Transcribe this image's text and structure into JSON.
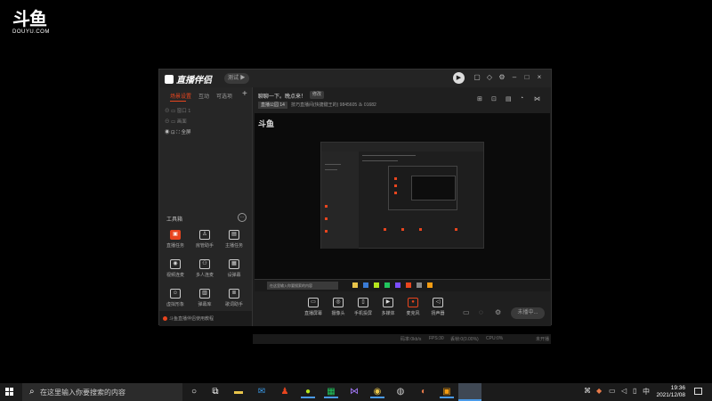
{
  "watermark": {
    "logo": "斗鱼",
    "sub": "DOUYU.COM"
  },
  "app": {
    "title": "直播伴侣",
    "version_badge": "测试 ▶",
    "main": {
      "room_title": "聊聊一下。晚点来！",
      "edit_label": "修改",
      "category": "直播公园 14",
      "room_info": "技巧直播间(快捷键王的)  9845605   ♨ 01682",
      "preview_logo": "斗鱼",
      "inner_search": "在这里输入你要搜索的内容"
    },
    "sidebar": {
      "tabs": [
        "场景设置",
        "互动",
        "可选项"
      ],
      "add_label": "+",
      "scenes": [
        "窗口 1",
        "画面",
        "全屏"
      ],
      "tools_title": "工具箱",
      "tools": [
        {
          "label": "直播任务",
          "icon": "task-icon"
        },
        {
          "label": "房管助手",
          "icon": "user-icon"
        },
        {
          "label": "主播任务",
          "icon": "gift-icon"
        },
        {
          "label": "视频连麦",
          "icon": "video-call-icon"
        },
        {
          "label": "多人连麦",
          "icon": "multi-call-icon"
        },
        {
          "label": "设弹幕",
          "icon": "barrage-icon"
        },
        {
          "label": "虚拟形象",
          "icon": "avatar-icon"
        },
        {
          "label": "弹幕库",
          "icon": "library-icon"
        },
        {
          "label": "歌词助手",
          "icon": "lyrics-icon"
        }
      ],
      "footer_tip": "斗鱼直播伴侣使用教程"
    },
    "controls": [
      {
        "label": "直播屏幕",
        "icon": "screen-icon"
      },
      {
        "label": "摄像头",
        "icon": "camera-icon"
      },
      {
        "label": "手机投屏",
        "icon": "phone-icon"
      },
      {
        "label": "多媒体",
        "icon": "media-icon"
      },
      {
        "label": "麦克风",
        "icon": "mic-icon"
      },
      {
        "label": "扬声器",
        "icon": "speaker-icon"
      }
    ],
    "start_label": "未播中...",
    "status": [
      "码率:0kb/s",
      "FPS:30",
      "丢帧:0(0.00%)",
      "CPU:0%",
      "未开播"
    ]
  },
  "taskbar": {
    "search_placeholder": "在这里输入你要搜索的内容",
    "time": "19:36",
    "date": "2021/12/08",
    "ime": "中",
    "accent": "#4a9ae8"
  }
}
